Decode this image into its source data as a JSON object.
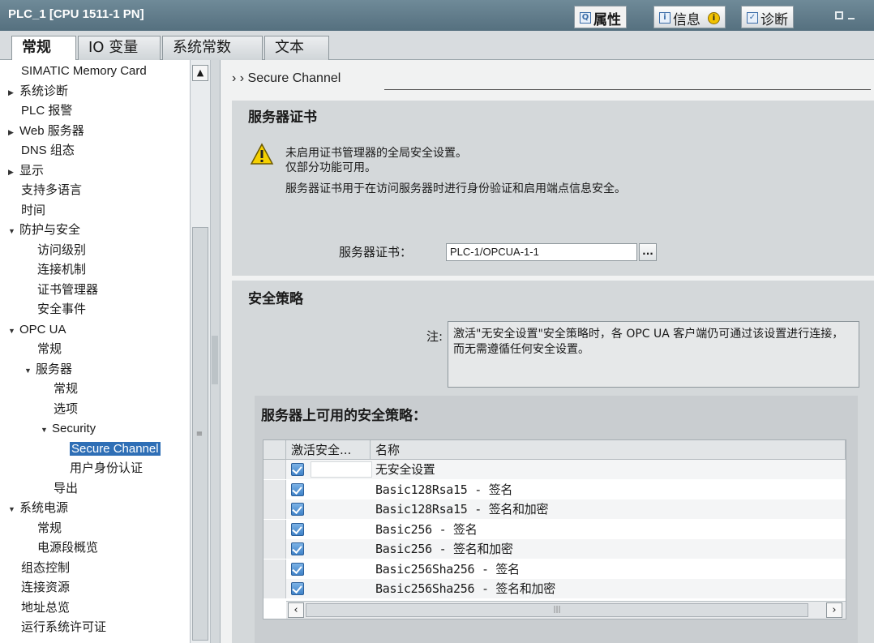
{
  "window": {
    "title": "PLC_1 [CPU 1511-1 PN]",
    "tabs": [
      {
        "label": "属性",
        "icon": "properties-icon",
        "active": true
      },
      {
        "label": "信息",
        "icon": "info-icon",
        "active": false
      },
      {
        "label": "诊断",
        "icon": "diagnostics-icon",
        "active": false
      }
    ],
    "info_badge": "i"
  },
  "tabs": [
    {
      "label": "常规",
      "active": true
    },
    {
      "label": "IO 变量",
      "active": false
    },
    {
      "label": "系统常数",
      "active": false
    },
    {
      "label": "文本",
      "active": false
    }
  ],
  "nav": {
    "items": [
      {
        "label": "SIMATIC Memory Card",
        "level": 0,
        "arrow": ""
      },
      {
        "label": "系统诊断",
        "level": 0,
        "arrow": "▶"
      },
      {
        "label": "PLC 报警",
        "level": 0,
        "arrow": ""
      },
      {
        "label": "Web 服务器",
        "level": 0,
        "arrow": "▶"
      },
      {
        "label": "DNS 组态",
        "level": 0,
        "arrow": ""
      },
      {
        "label": "显示",
        "level": 0,
        "arrow": "▶"
      },
      {
        "label": "支持多语言",
        "level": 0,
        "arrow": ""
      },
      {
        "label": "时间",
        "level": 0,
        "arrow": ""
      },
      {
        "label": "防护与安全",
        "level": 0,
        "arrow": "▼"
      },
      {
        "label": "访问级别",
        "level": 1,
        "arrow": ""
      },
      {
        "label": "连接机制",
        "level": 1,
        "arrow": ""
      },
      {
        "label": "证书管理器",
        "level": 1,
        "arrow": ""
      },
      {
        "label": "安全事件",
        "level": 1,
        "arrow": ""
      },
      {
        "label": "OPC UA",
        "level": 0,
        "arrow": "▼"
      },
      {
        "label": "常规",
        "level": 1,
        "arrow": ""
      },
      {
        "label": "服务器",
        "level": 1,
        "arrow": "▼"
      },
      {
        "label": "常规",
        "level": 2,
        "arrow": ""
      },
      {
        "label": "选项",
        "level": 2,
        "arrow": ""
      },
      {
        "label": "Security",
        "level": 2,
        "arrow": "▼"
      },
      {
        "label": "Secure Channel",
        "level": 3,
        "arrow": "",
        "selected": true
      },
      {
        "label": "用户身份认证",
        "level": 3,
        "arrow": ""
      },
      {
        "label": "导出",
        "level": 2,
        "arrow": ""
      },
      {
        "label": "系统电源",
        "level": 0,
        "arrow": "▼"
      },
      {
        "label": "常规",
        "level": 1,
        "arrow": ""
      },
      {
        "label": "电源段概览",
        "level": 1,
        "arrow": ""
      },
      {
        "label": "组态控制",
        "level": 0,
        "arrow": ""
      },
      {
        "label": "连接资源",
        "level": 0,
        "arrow": ""
      },
      {
        "label": "地址总览",
        "level": 0,
        "arrow": ""
      },
      {
        "label": "运行系统许可证",
        "level": 0,
        "arrow": ""
      }
    ]
  },
  "breadcrumb": "› ›  Secure Channel",
  "server_cert": {
    "title": "服务器证书",
    "warning_line1": "未启用证书管理器的全局安全设置。",
    "warning_line2": "仅部分功能可用。",
    "description": "服务器证书用于在访问服务器时进行身份验证和启用端点信息安全。",
    "field_label": "服务器证书：",
    "field_value": "PLC-1/OPCUA-1-1",
    "browse_button": "..."
  },
  "security_policy": {
    "title": "安全策略",
    "note_label": "注:",
    "note_text": "激活\"无安全设置\"安全策略时，各 OPC UA 客户端仍可通过该设置进行连接，而无需遵循任何安全设置。",
    "available_title": "服务器上可用的安全策略：",
    "columns": [
      "激活安全...",
      "名称"
    ],
    "rows": [
      {
        "name": "无安全设置",
        "active": true
      },
      {
        "name": "Basic128Rsa15 - 签名",
        "active": true
      },
      {
        "name": "Basic128Rsa15 - 签名和加密",
        "active": true
      },
      {
        "name": "Basic256 - 签名",
        "active": true
      },
      {
        "name": "Basic256 - 签名和加密",
        "active": true
      },
      {
        "name": "Basic256Sha256 - 签名",
        "active": true
      },
      {
        "name": "Basic256Sha256 - 签名和加密",
        "active": true
      }
    ]
  }
}
